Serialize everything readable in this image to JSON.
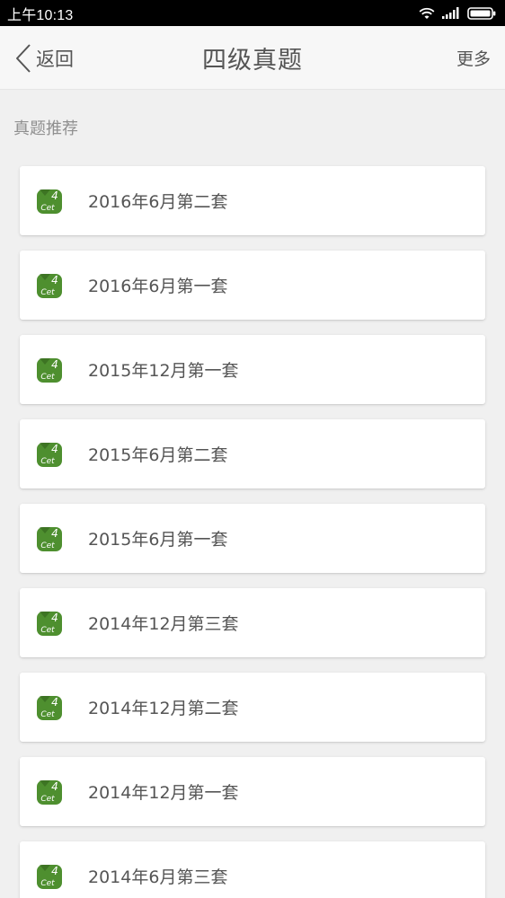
{
  "status_bar": {
    "time": "上午10:13",
    "icons": [
      "wifi-icon",
      "signal-icon",
      "battery-icon"
    ]
  },
  "nav": {
    "back_label": "返回",
    "title": "四级真题",
    "more_label": "更多"
  },
  "section": {
    "title": "真题推荐"
  },
  "icon": {
    "name": "cet4-icon",
    "number": "4",
    "text": "Cet",
    "color": "#4e8f2f"
  },
  "items": [
    {
      "label": "2016年6月第二套"
    },
    {
      "label": "2016年6月第一套"
    },
    {
      "label": "2015年12月第一套"
    },
    {
      "label": "2015年6月第二套"
    },
    {
      "label": "2015年6月第一套"
    },
    {
      "label": "2014年12月第三套"
    },
    {
      "label": "2014年12月第二套"
    },
    {
      "label": "2014年12月第一套"
    },
    {
      "label": "2014年6月第三套"
    }
  ]
}
